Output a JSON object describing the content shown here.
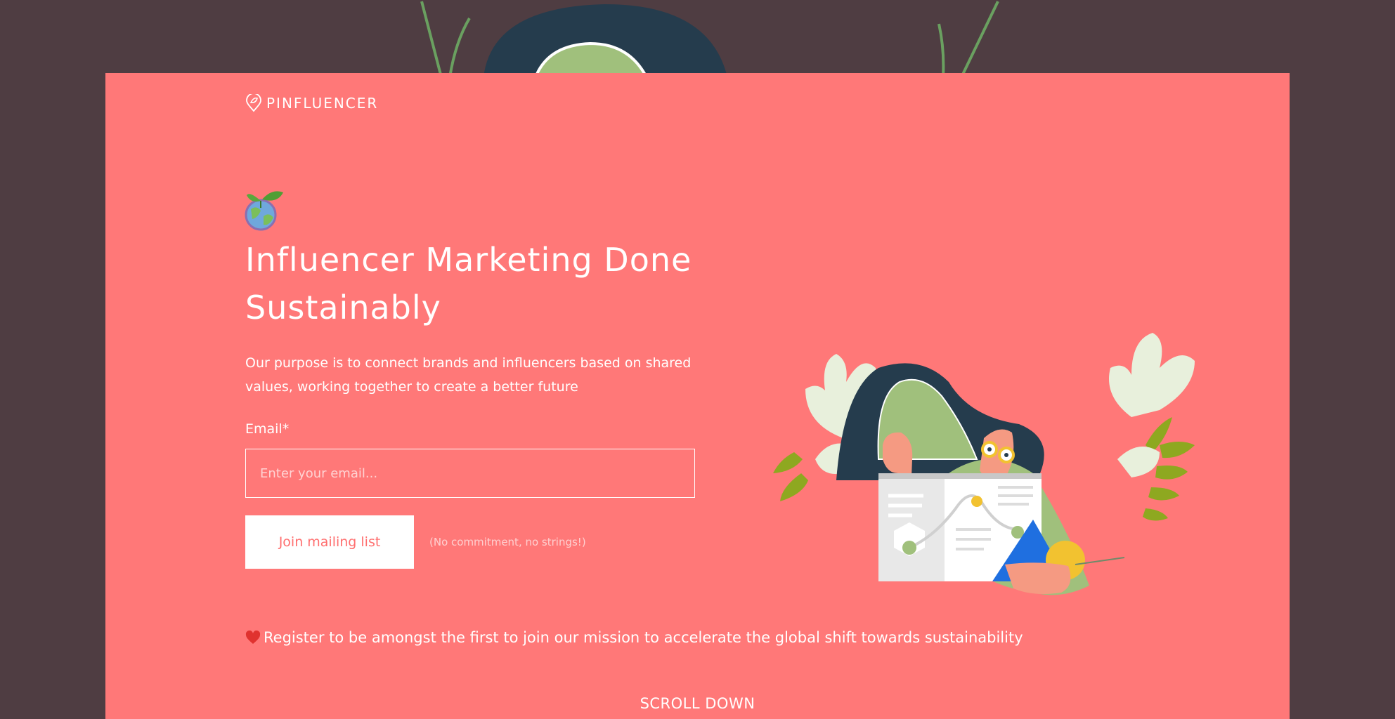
{
  "brand": {
    "name": "PINFLUENCER",
    "logo_icon": "pin-leaf-icon"
  },
  "hero": {
    "badge_icon": "globe-plant-icon",
    "headline": "Influencer Marketing Done Sustainably",
    "purpose": "Our purpose is to connect brands and influencers based on shared values, working together to create a better future"
  },
  "form": {
    "email_label": "Email*",
    "email_placeholder": "Enter your email...",
    "email_value": "",
    "submit_label": "Join mailing list",
    "note": "(No commitment, no strings!)"
  },
  "register": {
    "icon": "red-heart-icon",
    "text": "Register to be amongst the first to join our mission to accelerate the global shift towards sustainability"
  },
  "scroll_label": "SCROLL DOWN",
  "colors": {
    "background": "#4f3d42",
    "card": "#ff7878",
    "text": "#ffffff",
    "button_text": "#ff6f6f",
    "illustration_green": "#a0c07c",
    "illustration_navy": "#253c4d"
  }
}
